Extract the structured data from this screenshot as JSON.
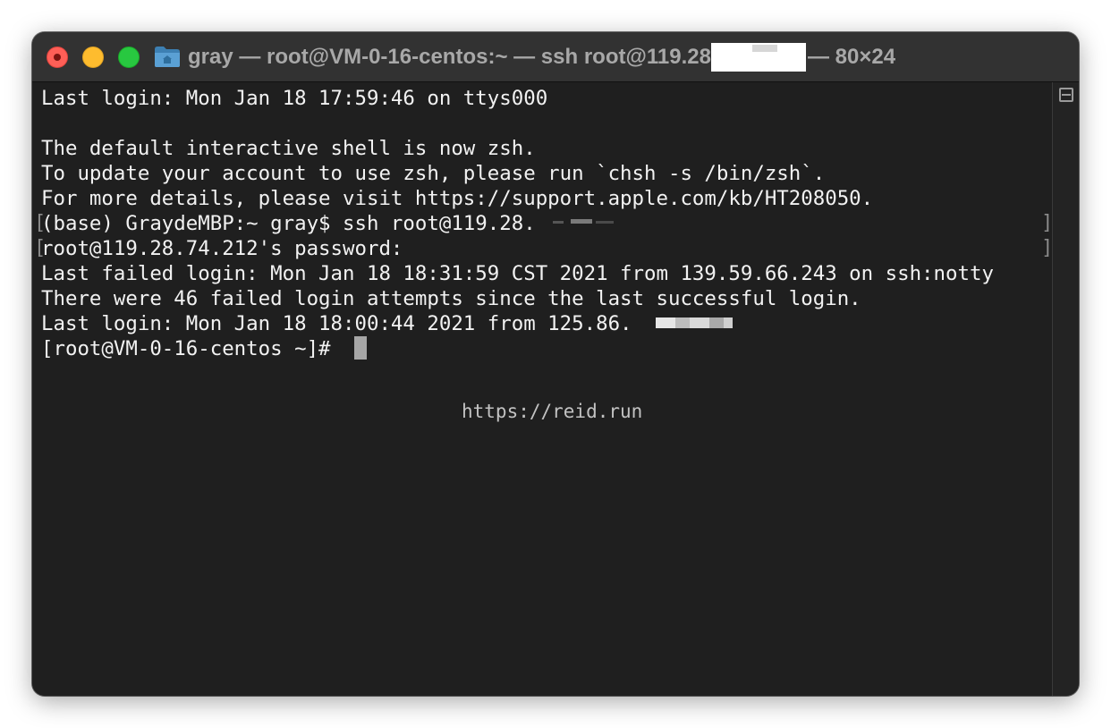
{
  "window": {
    "title_prefix": "gray — root@VM-0-16-centos:~ — ssh root@119.28",
    "title_suffix": "— 80×24"
  },
  "terminal": {
    "lines": [
      "Last login: Mon Jan 18 17:59:46 on ttys000",
      "",
      "The default interactive shell is now zsh.",
      "To update your account to use zsh, please run `chsh -s /bin/zsh`.",
      "For more details, please visit https://support.apple.com/kb/HT208050.",
      "(base) GraydeMBP:~ gray$ ssh root@119.28.",
      "root@119.28.74.212's password:",
      "Last failed login: Mon Jan 18 18:31:59 CST 2021 from 139.59.66.243 on ssh:notty",
      "There were 46 failed login attempts since the last successful login.",
      "Last login: Mon Jan 18 18:00:44 2021 from 125.86.",
      "[root@VM-0-16-centos ~]# "
    ],
    "bracket_left": "[",
    "bracket_right": "]"
  },
  "watermark": "https://reid.run",
  "colors": {
    "titlebar": "#323232",
    "terminal_bg": "#1f1f1f",
    "text": "#f2f2f2",
    "close": "#fe5f57",
    "minimize": "#febc2e",
    "maximize": "#28c840"
  }
}
